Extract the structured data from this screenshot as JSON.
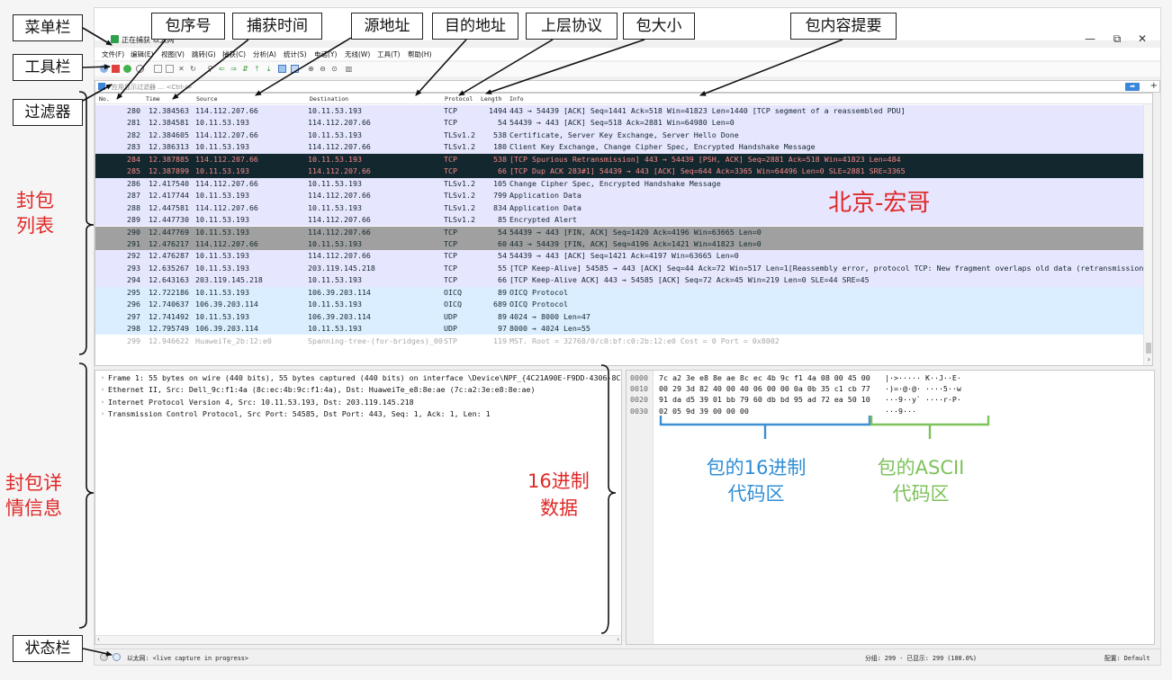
{
  "window": {
    "title": "正在捕获 以太网",
    "controls": {
      "minimize": "—",
      "restore": "⧉",
      "close": "✕"
    }
  },
  "menu": [
    "文件(F)",
    "编辑(E)",
    "视图(V)",
    "跳转(G)",
    "捕获(C)",
    "分析(A)",
    "统计(S)",
    "电话(Y)",
    "无线(W)",
    "工具(T)",
    "帮助(H)"
  ],
  "filter": {
    "placeholder": "应用显示过滤器 … <Ctrl-/>"
  },
  "columns": {
    "no": "No.",
    "time": "Time",
    "source": "Source",
    "destination": "Destination",
    "protocol": "Protocol",
    "length": "Length",
    "info": "Info"
  },
  "packets": [
    {
      "no": "280",
      "time": "12.384563",
      "src": "114.112.207.66",
      "dst": "10.11.53.193",
      "proto": "TCP",
      "len": "1494",
      "info": "443 → 54439 [ACK] Seq=1441 Ack=518 Win=41823 Len=1440 [TCP segment of a reassembled PDU]",
      "bg": "#e7e6ff",
      "fg": "#12272e"
    },
    {
      "no": "281",
      "time": "12.384581",
      "src": "10.11.53.193",
      "dst": "114.112.207.66",
      "proto": "TCP",
      "len": "54",
      "info": "54439 → 443 [ACK] Seq=518 Ack=2881 Win=64980 Len=0",
      "bg": "#e7e6ff",
      "fg": "#12272e"
    },
    {
      "no": "282",
      "time": "12.384605",
      "src": "114.112.207.66",
      "dst": "10.11.53.193",
      "proto": "TLSv1.2",
      "len": "538",
      "info": "Certificate, Server Key Exchange, Server Hello Done",
      "bg": "#e7e6ff",
      "fg": "#12272e"
    },
    {
      "no": "283",
      "time": "12.386313",
      "src": "10.11.53.193",
      "dst": "114.112.207.66",
      "proto": "TLSv1.2",
      "len": "180",
      "info": "Client Key Exchange, Change Cipher Spec, Encrypted Handshake Message",
      "bg": "#e7e6ff",
      "fg": "#12272e"
    },
    {
      "no": "284",
      "time": "12.387885",
      "src": "114.112.207.66",
      "dst": "10.11.53.193",
      "proto": "TCP",
      "len": "538",
      "info": "[TCP Spurious Retransmission] 443 → 54439 [PSH, ACK] Seq=2881 Ack=518 Win=41823 Len=484",
      "bg": "#12272e",
      "fg": "#f78787"
    },
    {
      "no": "285",
      "time": "12.387899",
      "src": "10.11.53.193",
      "dst": "114.112.207.66",
      "proto": "TCP",
      "len": "66",
      "info": "[TCP Dup ACK 283#1] 54439 → 443 [ACK] Seq=644 Ack=3365 Win=64496 Len=0 SLE=2881 SRE=3365",
      "bg": "#12272e",
      "fg": "#f78787"
    },
    {
      "no": "286",
      "time": "12.417540",
      "src": "114.112.207.66",
      "dst": "10.11.53.193",
      "proto": "TLSv1.2",
      "len": "105",
      "info": "Change Cipher Spec, Encrypted Handshake Message",
      "bg": "#e7e6ff",
      "fg": "#12272e"
    },
    {
      "no": "287",
      "time": "12.417744",
      "src": "10.11.53.193",
      "dst": "114.112.207.66",
      "proto": "TLSv1.2",
      "len": "799",
      "info": "Application Data",
      "bg": "#e7e6ff",
      "fg": "#12272e"
    },
    {
      "no": "288",
      "time": "12.447581",
      "src": "114.112.207.66",
      "dst": "10.11.53.193",
      "proto": "TLSv1.2",
      "len": "834",
      "info": "Application Data",
      "bg": "#e7e6ff",
      "fg": "#12272e"
    },
    {
      "no": "289",
      "time": "12.447730",
      "src": "10.11.53.193",
      "dst": "114.112.207.66",
      "proto": "TLSv1.2",
      "len": "85",
      "info": "Encrypted Alert",
      "bg": "#e7e6ff",
      "fg": "#12272e"
    },
    {
      "no": "290",
      "time": "12.447769",
      "src": "10.11.53.193",
      "dst": "114.112.207.66",
      "proto": "TCP",
      "len": "54",
      "info": "54439 → 443 [FIN, ACK] Seq=1420 Ack=4196 Win=63665 Len=0",
      "bg": "#a0a0a0",
      "fg": "#12272e"
    },
    {
      "no": "291",
      "time": "12.476217",
      "src": "114.112.207.66",
      "dst": "10.11.53.193",
      "proto": "TCP",
      "len": "60",
      "info": "443 → 54439 [FIN, ACK] Seq=4196 Ack=1421 Win=41823 Len=0",
      "bg": "#a0a0a0",
      "fg": "#12272e"
    },
    {
      "no": "292",
      "time": "12.476287",
      "src": "10.11.53.193",
      "dst": "114.112.207.66",
      "proto": "TCP",
      "len": "54",
      "info": "54439 → 443 [ACK] Seq=1421 Ack=4197 Win=63665 Len=0",
      "bg": "#e7e6ff",
      "fg": "#12272e"
    },
    {
      "no": "293",
      "time": "12.635267",
      "src": "10.11.53.193",
      "dst": "203.119.145.218",
      "proto": "TCP",
      "len": "55",
      "info": "[TCP Keep-Alive] 54585 → 443 [ACK] Seq=44 Ack=72 Win=517 Len=1[Reassembly error, protocol TCP: New fragment overlaps old data (retransmission?)]",
      "bg": "#e7e6ff",
      "fg": "#12272e"
    },
    {
      "no": "294",
      "time": "12.643163",
      "src": "203.119.145.218",
      "dst": "10.11.53.193",
      "proto": "TCP",
      "len": "66",
      "info": "[TCP Keep-Alive ACK] 443 → 54585 [ACK] Seq=72 Ack=45 Win=219 Len=0 SLE=44 SRE=45",
      "bg": "#e7e6ff",
      "fg": "#12272e"
    },
    {
      "no": "295",
      "time": "12.722186",
      "src": "10.11.53.193",
      "dst": "106.39.203.114",
      "proto": "OICQ",
      "len": "89",
      "info": "OICQ Protocol",
      "bg": "#daeeff",
      "fg": "#12272e"
    },
    {
      "no": "296",
      "time": "12.740637",
      "src": "106.39.203.114",
      "dst": "10.11.53.193",
      "proto": "OICQ",
      "len": "689",
      "info": "OICQ Protocol",
      "bg": "#daeeff",
      "fg": "#12272e"
    },
    {
      "no": "297",
      "time": "12.741492",
      "src": "10.11.53.193",
      "dst": "106.39.203.114",
      "proto": "UDP",
      "len": "89",
      "info": "4024 → 8000 Len=47",
      "bg": "#daeeff",
      "fg": "#12272e"
    },
    {
      "no": "298",
      "time": "12.795749",
      "src": "106.39.203.114",
      "dst": "10.11.53.193",
      "proto": "UDP",
      "len": "97",
      "info": "8000 → 4024 Len=55",
      "bg": "#daeeff",
      "fg": "#12272e"
    },
    {
      "no": "299",
      "time": "12.946622",
      "src": "HuaweiTe_2b:12:e0",
      "dst": "Spanning-tree-(for-bridges)_00",
      "proto": "STP",
      "len": "119",
      "info": "MST. Root = 32768/0/c0:bf:c0:2b:12:e0  Cost = 0  Port = 0x8002",
      "bg": "#ffffff",
      "fg": "#a8a8a8"
    }
  ],
  "details": [
    "Frame 1: 55 bytes on wire (440 bits), 55 bytes captured (440 bits) on interface \\Device\\NPF_{4C21A90E-F9DD-4306-8C84-",
    "Ethernet II, Src: Dell_9c:f1:4a (8c:ec:4b:9c:f1:4a), Dst: HuaweiTe_e8:8e:ae (7c:a2:3e:e8:8e:ae)",
    "Internet Protocol Version 4, Src: 10.11.53.193, Dst: 203.119.145.218",
    "Transmission Control Protocol, Src Port: 54585, Dst Port: 443, Seq: 1, Ack: 1, Len: 1"
  ],
  "bytes": [
    {
      "off": "0000",
      "hex": "7c a2 3e e8 8e ae 8c ec  4b 9c f1 4a 08 00 45 00",
      "ascii": "|·>····· K··J··E·"
    },
    {
      "off": "0010",
      "hex": "00 29 3d 82 40 00 40 06  00 00 0a 0b 35 c1 cb 77",
      "ascii": "·)=·@·@· ····5··w"
    },
    {
      "off": "0020",
      "hex": "91 da d5 39 01 bb 79 60  db bd 95 ad 72 ea 50 10",
      "ascii": "···9··y` ····r·P·"
    },
    {
      "off": "0030",
      "hex": "02 05 9d 39 00 00 00",
      "ascii": "···9···"
    }
  ],
  "status": {
    "interface": "以太网: <live capture in progress>",
    "counts": "分组: 299 · 已显示: 299 (100.0%)",
    "profile": "配置: Default"
  },
  "annotations": {
    "menubar": "菜单栏",
    "toolbar": "工具栏",
    "filter": "过滤器",
    "statusbar": "状态栏",
    "no": "包序号",
    "time": "捕获时间",
    "src": "源地址",
    "dst": "目的地址",
    "proto": "上层协议",
    "len": "包大小",
    "info": "包内容提要",
    "packet_list_1": "封包",
    "packet_list_2": "列表",
    "details_1": "封包详",
    "details_2": "情信息",
    "hex_data_1": "16进制",
    "hex_data_2": "数据",
    "watermark": "北京-宏哥",
    "hex_area_1": "包的16进制",
    "hex_area_2": "代码区",
    "ascii_area_1": "包的ASCII",
    "ascii_area_2": "代码区"
  },
  "colors": {
    "annotation_red": "#e02828",
    "annotation_blue": "#2f8ed6",
    "annotation_green": "#7dc25a"
  }
}
